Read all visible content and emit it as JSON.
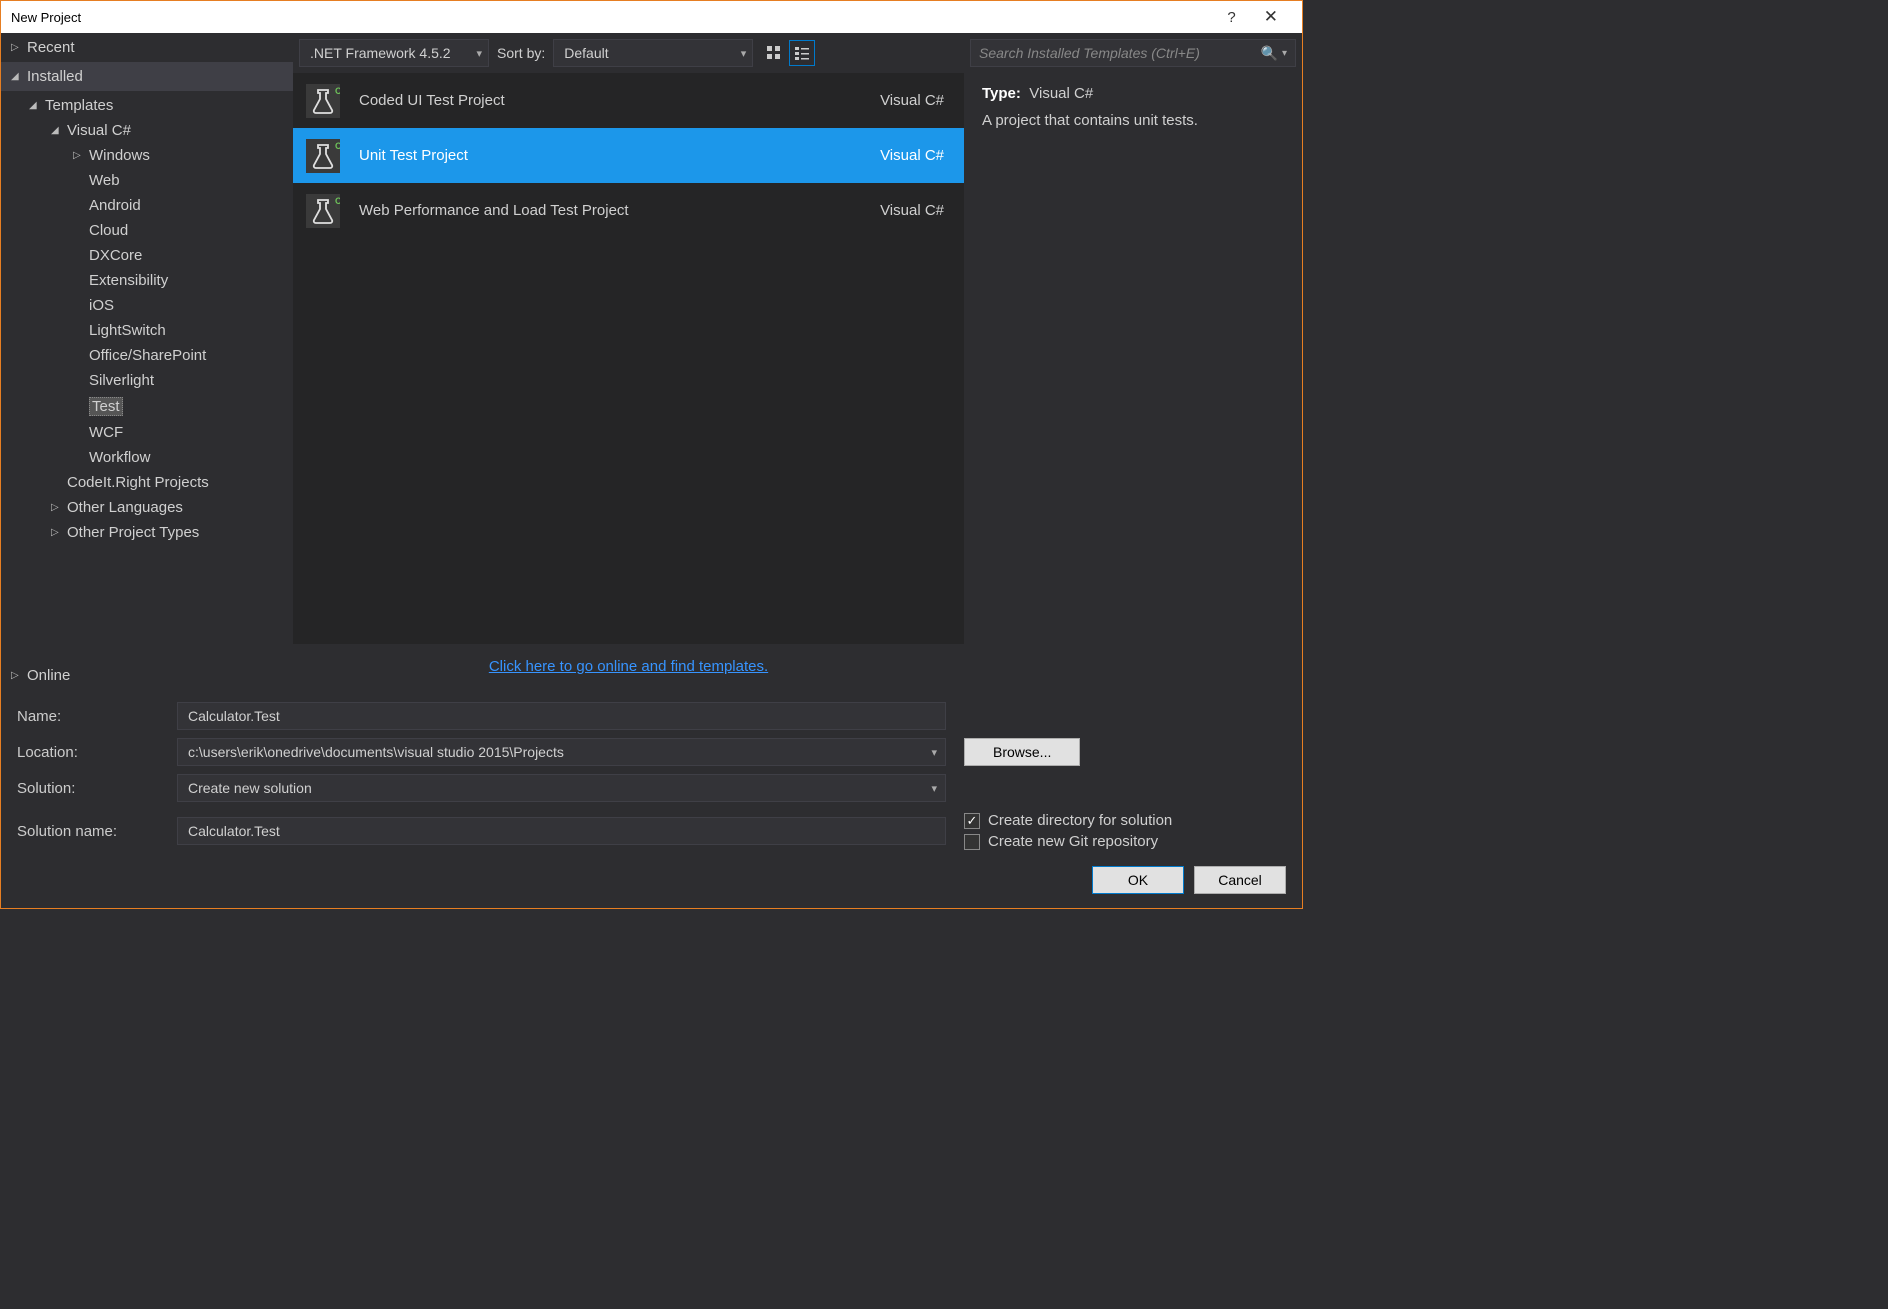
{
  "window": {
    "title": "New Project"
  },
  "sidebar": {
    "recent_label": "Recent",
    "installed_label": "Installed",
    "online_label": "Online",
    "templates_label": "Templates",
    "visual_csharp_label": "Visual C#",
    "categories": [
      "Windows",
      "Web",
      "Android",
      "Cloud",
      "DXCore",
      "Extensibility",
      "iOS",
      "LightSwitch",
      "Office/SharePoint",
      "Silverlight",
      "Test",
      "WCF",
      "Workflow"
    ],
    "selected_category": "Test",
    "codeit_label": "CodeIt.Right Projects",
    "other_languages_label": "Other Languages",
    "other_project_types_label": "Other Project Types"
  },
  "toolbar": {
    "framework": ".NET Framework 4.5.2",
    "sort_by_label": "Sort by:",
    "sort_value": "Default"
  },
  "templates": [
    {
      "name": "Coded UI Test Project",
      "lang": "Visual C#"
    },
    {
      "name": "Unit Test Project",
      "lang": "Visual C#"
    },
    {
      "name": "Web Performance and Load Test Project",
      "lang": "Visual C#"
    }
  ],
  "selected_template_index": 1,
  "online_link_text": "Click here to go online and find templates.",
  "right": {
    "search_placeholder": "Search Installed Templates (Ctrl+E)",
    "type_label": "Type:",
    "type_value": "Visual C#",
    "description": "A project that contains unit tests."
  },
  "form": {
    "name_label": "Name:",
    "name_value": "Calculator.Test",
    "location_label": "Location:",
    "location_value": "c:\\users\\erik\\onedrive\\documents\\visual studio 2015\\Projects",
    "solution_label": "Solution:",
    "solution_value": "Create new solution",
    "solution_name_label": "Solution name:",
    "solution_name_value": "Calculator.Test",
    "browse_label": "Browse...",
    "create_dir_label": "Create directory for solution",
    "create_git_label": "Create new Git repository",
    "create_dir_checked": true,
    "create_git_checked": false
  },
  "buttons": {
    "ok": "OK",
    "cancel": "Cancel"
  }
}
